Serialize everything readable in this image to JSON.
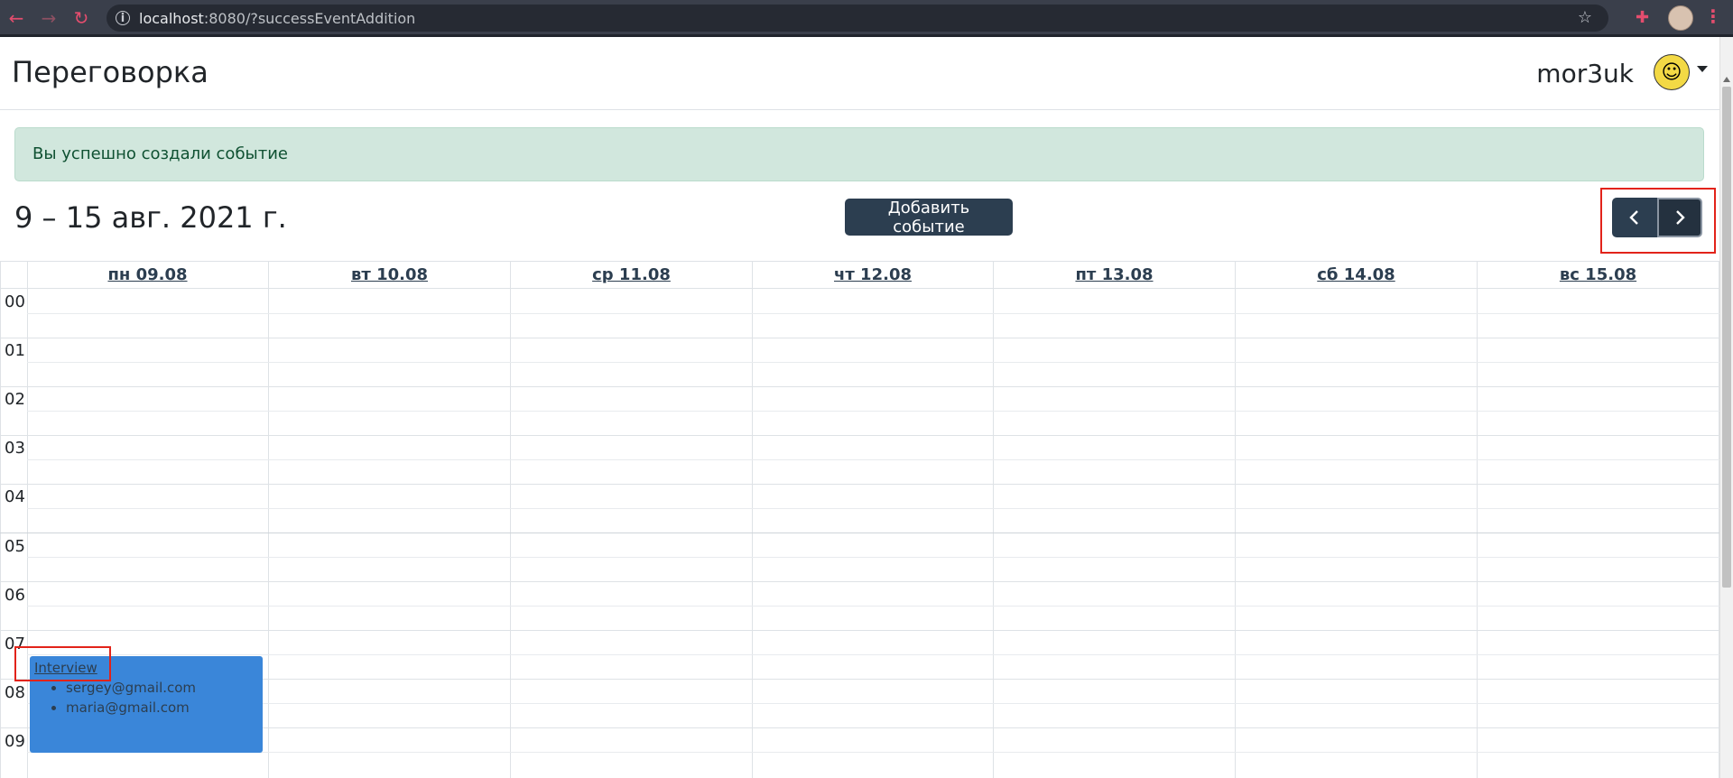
{
  "browser": {
    "url_host": "localhost",
    "url_rest": ":8080/?successEventAddition"
  },
  "navbar": {
    "brand": "Переговорка",
    "username": "mor3uk"
  },
  "alert": {
    "text": "Вы успешно создали событие"
  },
  "toolbar": {
    "week_title": "9 – 15 авг. 2021 г.",
    "add_event_label": "Добавить событие",
    "prev_icon": "chevron-left-icon",
    "next_icon": "chevron-right-icon"
  },
  "calendar": {
    "days": [
      "пн 09.08",
      "вт 10.08",
      "ср 11.08",
      "чт 12.08",
      "пт 13.08",
      "сб 14.08",
      "вс 15.08"
    ],
    "hours": [
      "00",
      "01",
      "02",
      "03",
      "04",
      "05",
      "06",
      "07",
      "08",
      "09"
    ],
    "events": [
      {
        "title": "Interview",
        "day": "пн 09.08",
        "start": "07:30",
        "participants": [
          "sergey@gmail.com",
          "maria@gmail.com"
        ],
        "color": "#3a86d9"
      }
    ]
  },
  "colors": {
    "primary_dark": "#2c3e50",
    "alert_bg": "#d1e7dd",
    "alert_text": "#0f5132",
    "highlight": "#e2231a"
  }
}
